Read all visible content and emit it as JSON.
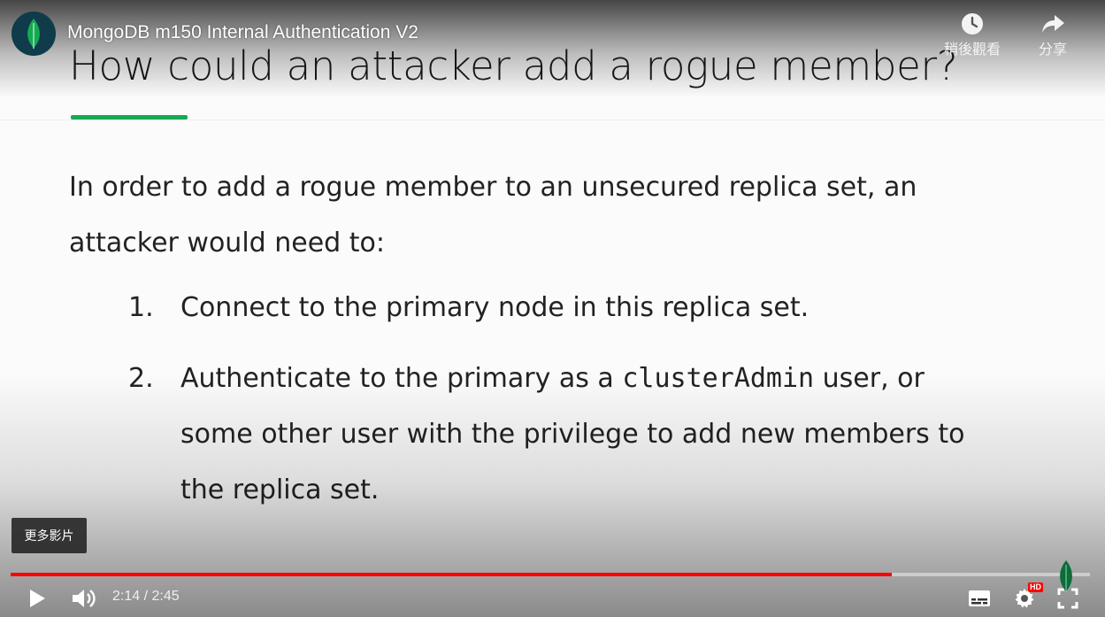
{
  "player": {
    "video_title": "MongoDB m150 Internal Authentication V2",
    "watch_later_label": "稍後觀看",
    "share_label": "分享",
    "more_videos_label": "更多影片",
    "time_display": "2:14 / 2:45",
    "progress_fraction": 0.816,
    "hd_badge": "HD",
    "accent_color": "#ff0000"
  },
  "slide": {
    "title": "How could an attacker add a rogue member?",
    "intro": "In order to add a rogue member to an unsecured replica set, an attacker would need to:",
    "items": [
      {
        "number": "1.",
        "text": "Connect to the primary node in this replica set."
      },
      {
        "number": "2.",
        "text_before": "Authenticate to the primary as a ",
        "code": "clusterAdmin",
        "text_after": " user, or some other user with the privilege to add new members to the replica set."
      }
    ],
    "rule_color": "#13aa52"
  },
  "icons": {
    "channel_logo": "mongodb-leaf-icon",
    "watch_later": "clock-icon",
    "share": "share-arrow-icon",
    "play": "play-icon",
    "volume": "volume-icon",
    "subtitles": "subtitles-icon",
    "settings": "gear-icon",
    "fullscreen": "fullscreen-icon"
  }
}
